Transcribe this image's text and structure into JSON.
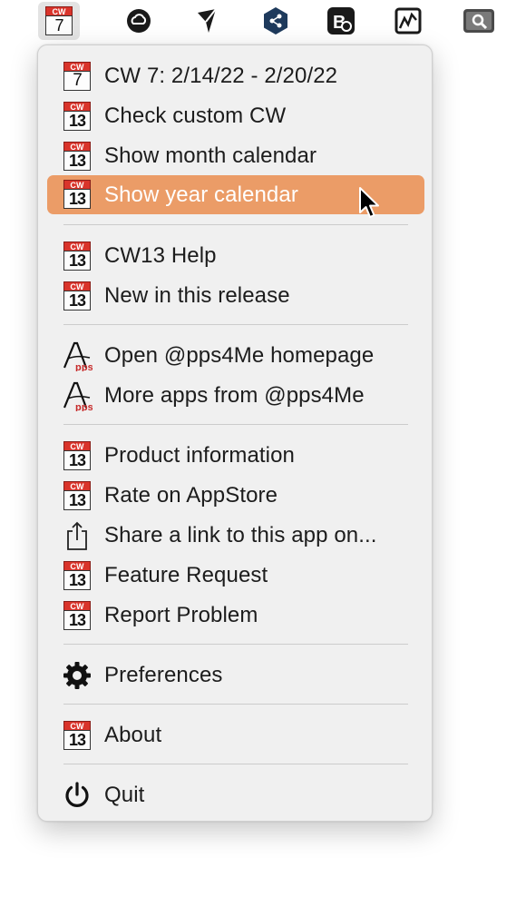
{
  "menubar": {
    "items": [
      {
        "name": "cw13-menubar-icon",
        "cal_top": "CW",
        "cal_num": "7"
      },
      {
        "name": "creative-cloud-icon"
      },
      {
        "name": "testflight-icon"
      },
      {
        "name": "sourcetree-icon"
      },
      {
        "name": "bartender-icon"
      },
      {
        "name": "istat-menus-icon"
      },
      {
        "name": "search-icon"
      }
    ]
  },
  "menu": {
    "items": [
      {
        "label": "CW 7:  2/14/22 - 2/20/22",
        "icon": "cw7-calendar-icon",
        "cal_top": "CW",
        "cal_num": "7"
      },
      {
        "label": "Check custom CW",
        "icon": "cw13-calendar-icon",
        "cal_top": "CW",
        "cal_num": "13"
      },
      {
        "label": "Show month calendar",
        "icon": "cw13-calendar-icon",
        "cal_top": "CW",
        "cal_num": "13"
      },
      {
        "label": "Show year calendar",
        "icon": "cw13-calendar-icon",
        "cal_top": "CW",
        "cal_num": "13",
        "highlighted": true
      },
      {
        "label": "CW13 Help",
        "icon": "cw13-calendar-icon",
        "cal_top": "CW",
        "cal_num": "13"
      },
      {
        "label": "New in this release",
        "icon": "cw13-calendar-icon",
        "cal_top": "CW",
        "cal_num": "13"
      },
      {
        "label": "Open @pps4Me homepage",
        "icon": "apps4me-logo-icon",
        "logo_text": "pps"
      },
      {
        "label": "More apps from @pps4Me",
        "icon": "apps4me-logo-icon",
        "logo_text": "pps"
      },
      {
        "label": "Product information",
        "icon": "cw13-calendar-icon",
        "cal_top": "CW",
        "cal_num": "13"
      },
      {
        "label": "Rate on AppStore",
        "icon": "cw13-calendar-icon",
        "cal_top": "CW",
        "cal_num": "13"
      },
      {
        "label": "Share a link to this app on...",
        "icon": "share-icon"
      },
      {
        "label": "Feature Request",
        "icon": "cw13-calendar-icon",
        "cal_top": "CW",
        "cal_num": "13"
      },
      {
        "label": "Report Problem",
        "icon": "cw13-calendar-icon",
        "cal_top": "CW",
        "cal_num": "13"
      },
      {
        "label": "Preferences",
        "icon": "gear-icon"
      },
      {
        "label": "About",
        "icon": "cw13-calendar-icon",
        "cal_top": "CW",
        "cal_num": "13"
      },
      {
        "label": "Quit",
        "icon": "power-icon"
      }
    ],
    "highlight_color": "#eb9c67"
  }
}
